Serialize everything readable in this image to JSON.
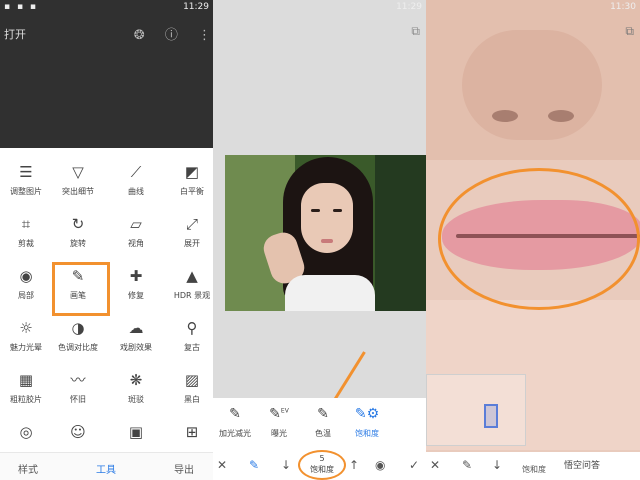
{
  "status_bar": {
    "p1_time": "11:29",
    "p2_time": "11:29",
    "p3_time": "11:30",
    "left_icons": "▪ ▪ ▪"
  },
  "panel1": {
    "title": "打开",
    "tools": [
      {
        "label": "调整图片",
        "icon": "adjust-icon",
        "glyph": "☰"
      },
      {
        "label": "突出细节",
        "icon": "details-icon",
        "glyph": "▽"
      },
      {
        "label": "曲线",
        "icon": "curves-icon",
        "glyph": "⟋"
      },
      {
        "label": "白平衡",
        "icon": "white-balance-icon",
        "glyph": "◩"
      },
      {
        "label": "剪裁",
        "icon": "crop-icon",
        "glyph": "⌗"
      },
      {
        "label": "旋转",
        "icon": "rotate-icon",
        "glyph": "↻"
      },
      {
        "label": "视角",
        "icon": "perspective-icon",
        "glyph": "▱"
      },
      {
        "label": "展开",
        "icon": "expand-icon",
        "glyph": "⤢"
      },
      {
        "label": "局部",
        "icon": "selective-icon",
        "glyph": "◉"
      },
      {
        "label": "画笔",
        "icon": "brush-icon",
        "glyph": "✎"
      },
      {
        "label": "修复",
        "icon": "healing-icon",
        "glyph": "✚"
      },
      {
        "label": "HDR 景观",
        "icon": "hdr-icon",
        "glyph": "▲"
      },
      {
        "label": "魅力光晕",
        "icon": "glamour-glow-icon",
        "glyph": "☼"
      },
      {
        "label": "色调对比度",
        "icon": "tonal-contrast-icon",
        "glyph": "◑"
      },
      {
        "label": "戏剧效果",
        "icon": "drama-icon",
        "glyph": "☁"
      },
      {
        "label": "复古",
        "icon": "vintage-icon",
        "glyph": "⚲"
      },
      {
        "label": "粗粒胶片",
        "icon": "grainy-film-icon",
        "glyph": "▦"
      },
      {
        "label": "怀旧",
        "icon": "retrolux-icon",
        "glyph": "〰"
      },
      {
        "label": "斑驳",
        "icon": "grunge-icon",
        "glyph": "❋"
      },
      {
        "label": "黑白",
        "icon": "black-white-icon",
        "glyph": "▨"
      },
      {
        "label": "",
        "icon": "film-reel-icon",
        "glyph": "◎"
      },
      {
        "label": "",
        "icon": "face-icon",
        "glyph": "☺"
      },
      {
        "label": "",
        "icon": "portrait-icon",
        "glyph": "▣"
      },
      {
        "label": "",
        "icon": "frame-icon",
        "glyph": "⊞"
      }
    ],
    "tabs": {
      "styles": "样式",
      "tools": "工具",
      "export": "导出"
    }
  },
  "panel2": {
    "brushes": [
      {
        "label": "加光减光",
        "icon": "dodge-burn-brush-icon"
      },
      {
        "label": "曝光",
        "icon": "exposure-brush-icon"
      },
      {
        "label": "色温",
        "icon": "temperature-brush-icon"
      },
      {
        "label": "饱和度",
        "icon": "saturation-brush-icon"
      }
    ],
    "ev_tag": "EV",
    "value": "5",
    "value_label": "饱和度"
  },
  "panel3": {
    "saturation_label": "饱和度",
    "watermark": "悟空问答"
  },
  "colors": {
    "accent_blue": "#2b7be5",
    "highlight_orange": "#f2912f"
  }
}
